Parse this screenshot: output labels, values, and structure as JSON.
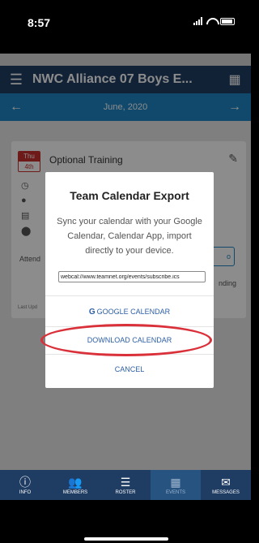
{
  "status": {
    "time": "8:57"
  },
  "header": {
    "title": "NWC Alliance 07 Boys E..."
  },
  "month_bar": {
    "month": "June, 2020"
  },
  "event": {
    "dow": "Thu",
    "day": "4th",
    "title": "Optional Training",
    "attend_label": "Attend",
    "pending_partial": "o",
    "pending_text": "nding",
    "last_updated": "Last Upd"
  },
  "modal": {
    "title": "Team Calendar Export",
    "description": "Sync your calendar with your Google Calendar, Calendar App, import directly to your device.",
    "url": "webcal://www.teamnet.org/events/subscribe.ics",
    "google_letter": "G",
    "google_label": "GOOGLE CALENDAR",
    "download_label": "DOWNLOAD CALENDAR",
    "cancel_label": "CANCEL",
    "highlight_color": "#d9303a"
  },
  "tabs": [
    {
      "label": "INFO",
      "icon": "info-icon"
    },
    {
      "label": "MEMBERS",
      "icon": "members-icon"
    },
    {
      "label": "ROSTER",
      "icon": "roster-icon"
    },
    {
      "label": "EVENTS",
      "icon": "calendar-icon"
    },
    {
      "label": "MESSAGES",
      "icon": "envelope-icon"
    }
  ],
  "colors": {
    "appbar": "#1f3c63",
    "monthbar": "#1e86c4",
    "accent": "#c8302f"
  }
}
